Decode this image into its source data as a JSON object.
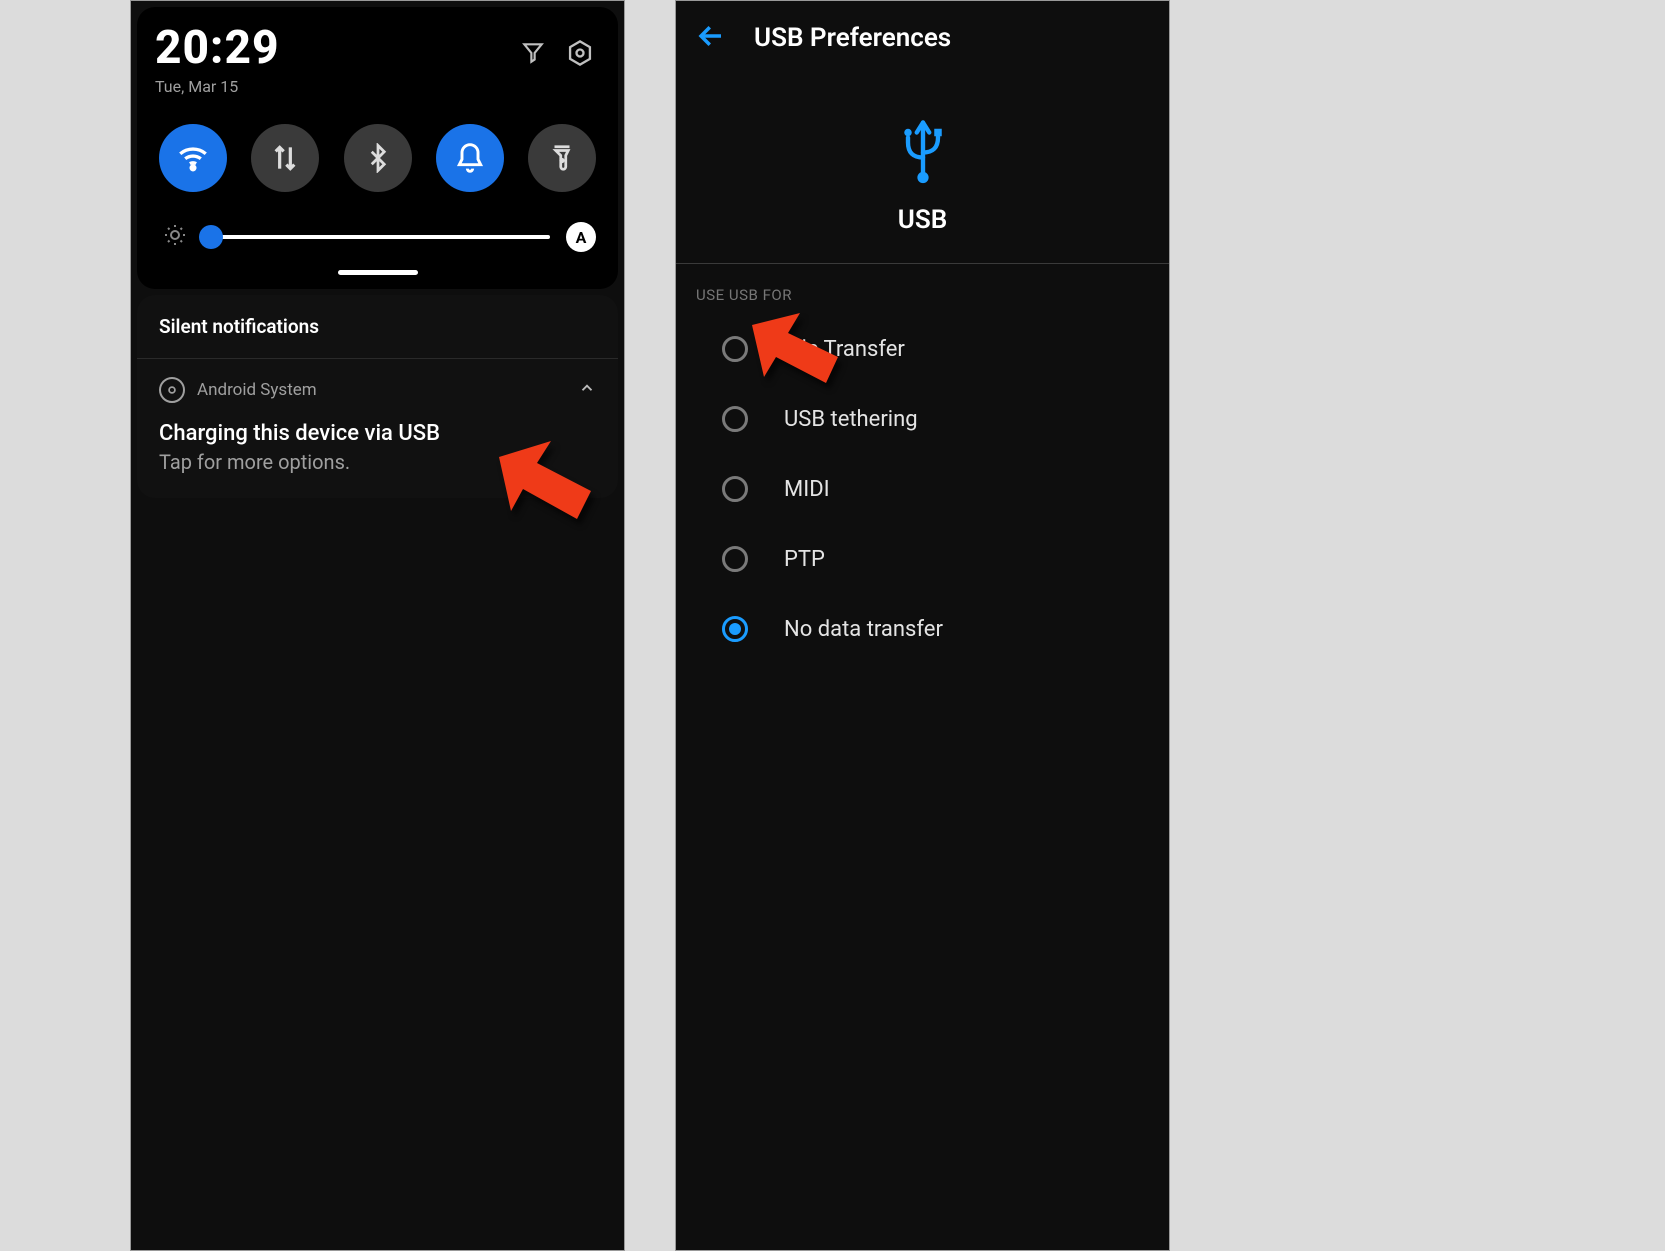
{
  "left": {
    "time": "20:29",
    "date": "Tue, Mar 15",
    "tiles": [
      {
        "name": "wifi",
        "active": true
      },
      {
        "name": "data",
        "active": false
      },
      {
        "name": "bluetooth",
        "active": false
      },
      {
        "name": "dnd-bell",
        "active": true
      },
      {
        "name": "flashlight",
        "active": false
      }
    ],
    "auto_brightness_badge": "A",
    "silent_header": "Silent notifications",
    "notification": {
      "source": "Android System",
      "title": "Charging this device via USB",
      "subtitle": "Tap for more options."
    }
  },
  "right": {
    "header_title": "USB Preferences",
    "hero_label": "USB",
    "section_label": "USE USB FOR",
    "options": [
      {
        "label": "File Transfer",
        "selected": false
      },
      {
        "label": "USB tethering",
        "selected": false
      },
      {
        "label": "MIDI",
        "selected": false
      },
      {
        "label": "PTP",
        "selected": false
      },
      {
        "label": "No data transfer",
        "selected": true
      }
    ]
  }
}
